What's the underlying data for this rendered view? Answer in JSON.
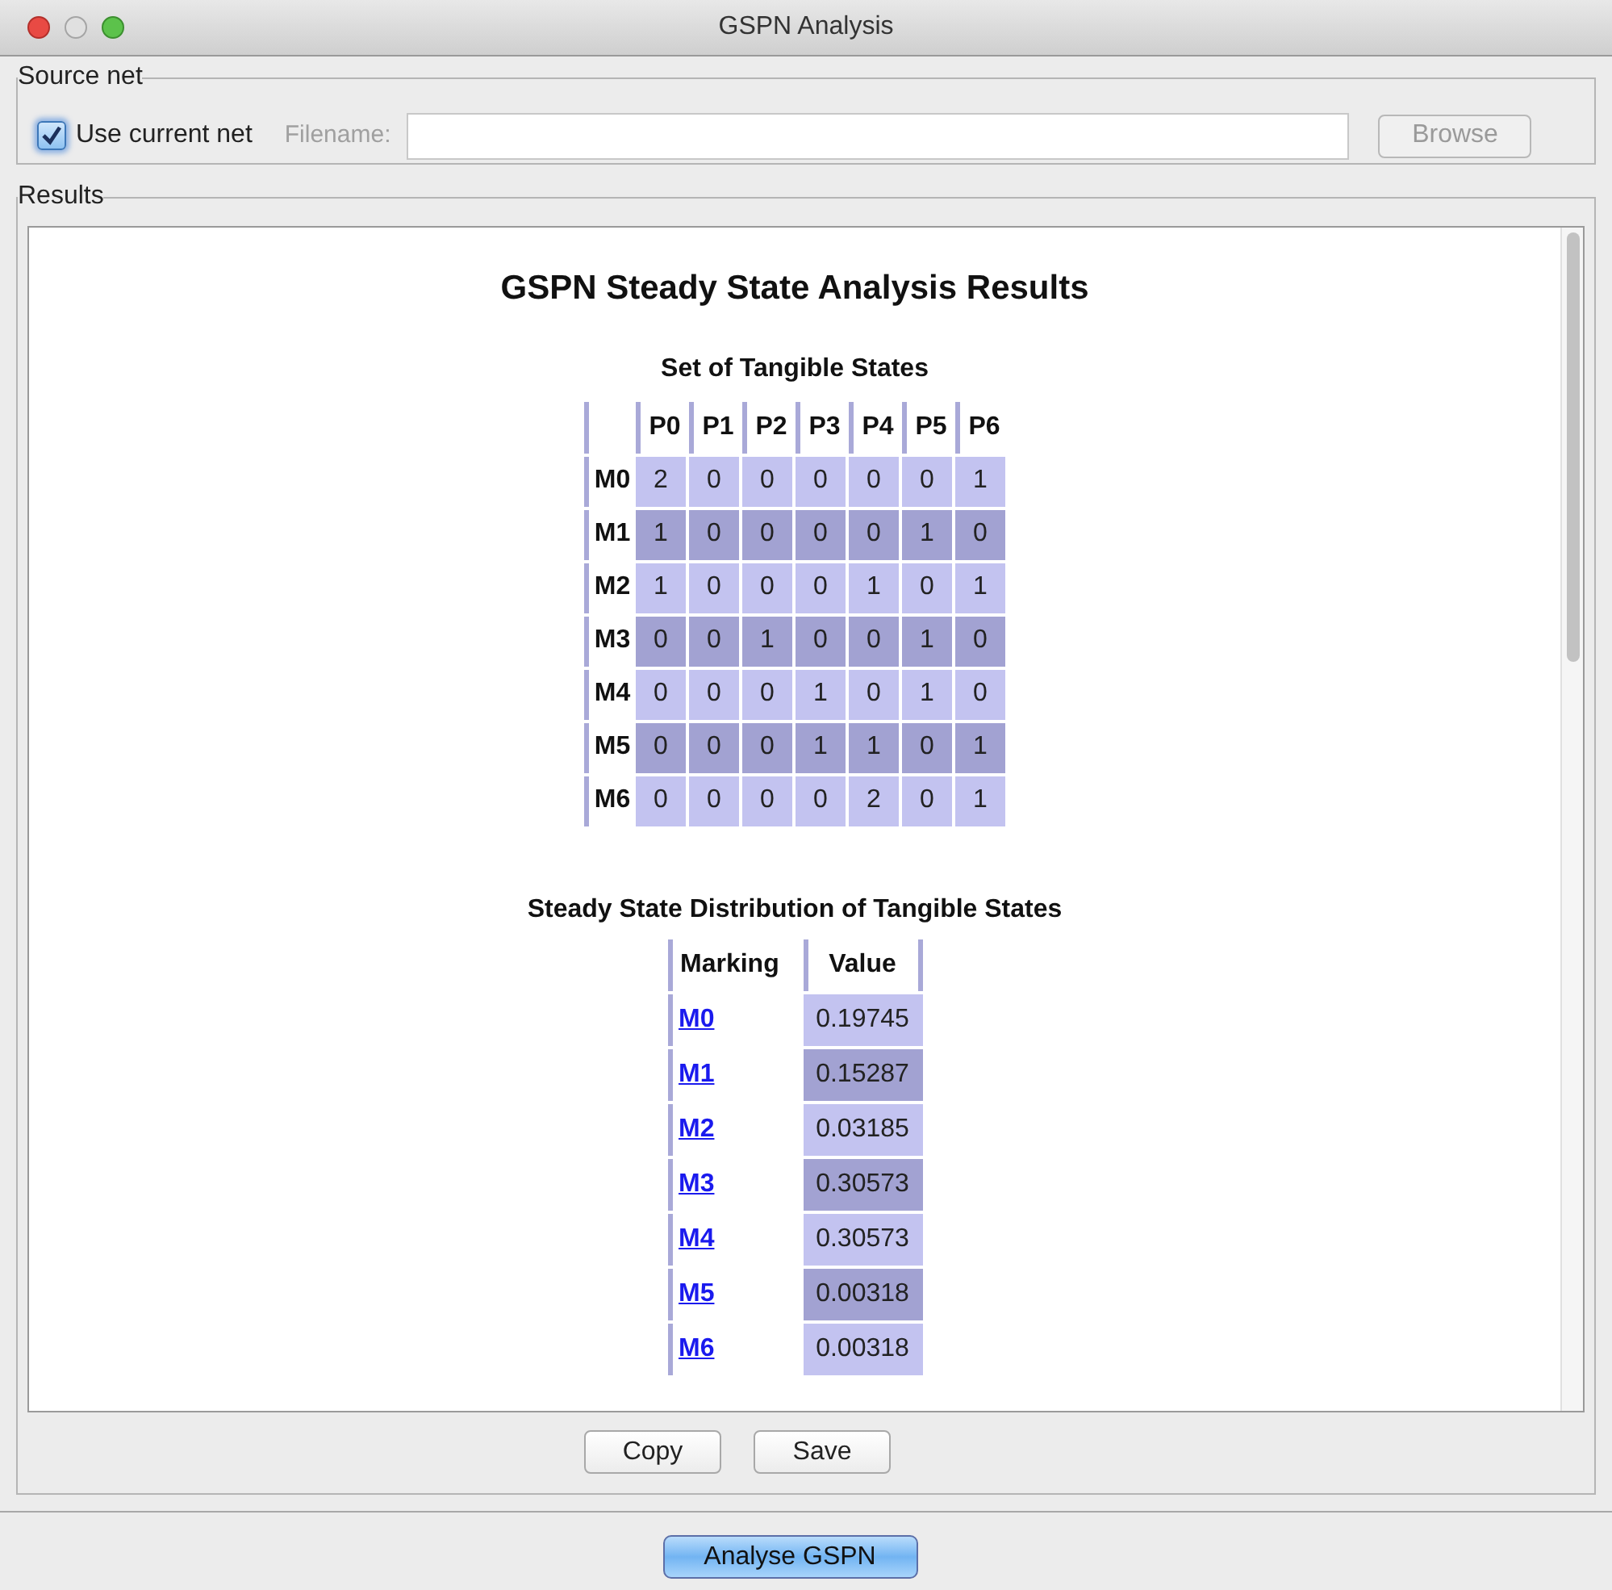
{
  "window": {
    "title": "GSPN Analysis"
  },
  "source_net": {
    "title": "Source net",
    "use_current_net": {
      "label": "Use current net",
      "checked": true
    },
    "filename": {
      "label": "Filename:",
      "disabled": true
    },
    "browse_button": {
      "label": "Browse",
      "disabled": true
    }
  },
  "results": {
    "title": "Results",
    "heading": "GSPN Steady State Analysis Results",
    "tangible_states": {
      "title": "Set of Tangible States",
      "columns": [
        "P0",
        "P1",
        "P2",
        "P3",
        "P4",
        "P5",
        "P6"
      ],
      "rows": [
        {
          "marking": "M0",
          "values": [
            "2",
            "0",
            "0",
            "0",
            "0",
            "0",
            "1"
          ]
        },
        {
          "marking": "M1",
          "values": [
            "1",
            "0",
            "0",
            "0",
            "0",
            "1",
            "0"
          ]
        },
        {
          "marking": "M2",
          "values": [
            "1",
            "0",
            "0",
            "0",
            "1",
            "0",
            "1"
          ]
        },
        {
          "marking": "M3",
          "values": [
            "0",
            "0",
            "1",
            "0",
            "0",
            "1",
            "0"
          ]
        },
        {
          "marking": "M4",
          "values": [
            "0",
            "0",
            "0",
            "1",
            "0",
            "1",
            "0"
          ]
        },
        {
          "marking": "M5",
          "values": [
            "0",
            "0",
            "0",
            "1",
            "1",
            "0",
            "1"
          ]
        },
        {
          "marking": "M6",
          "values": [
            "0",
            "0",
            "0",
            "0",
            "2",
            "0",
            "1"
          ]
        }
      ]
    },
    "distribution": {
      "title": "Steady State Distribution of Tangible States",
      "columns": [
        "Marking",
        "Value"
      ],
      "rows": [
        {
          "marking": "M0",
          "value": "0.19745"
        },
        {
          "marking": "M1",
          "value": "0.15287"
        },
        {
          "marking": "M2",
          "value": "0.03185"
        },
        {
          "marking": "M3",
          "value": "0.30573"
        },
        {
          "marking": "M4",
          "value": "0.30573"
        },
        {
          "marking": "M5",
          "value": "0.00318"
        },
        {
          "marking": "M6",
          "value": "0.00318"
        }
      ]
    },
    "buttons": [
      "Copy",
      "Save"
    ]
  },
  "analyse_button": {
    "label": "Analyse GSPN"
  }
}
